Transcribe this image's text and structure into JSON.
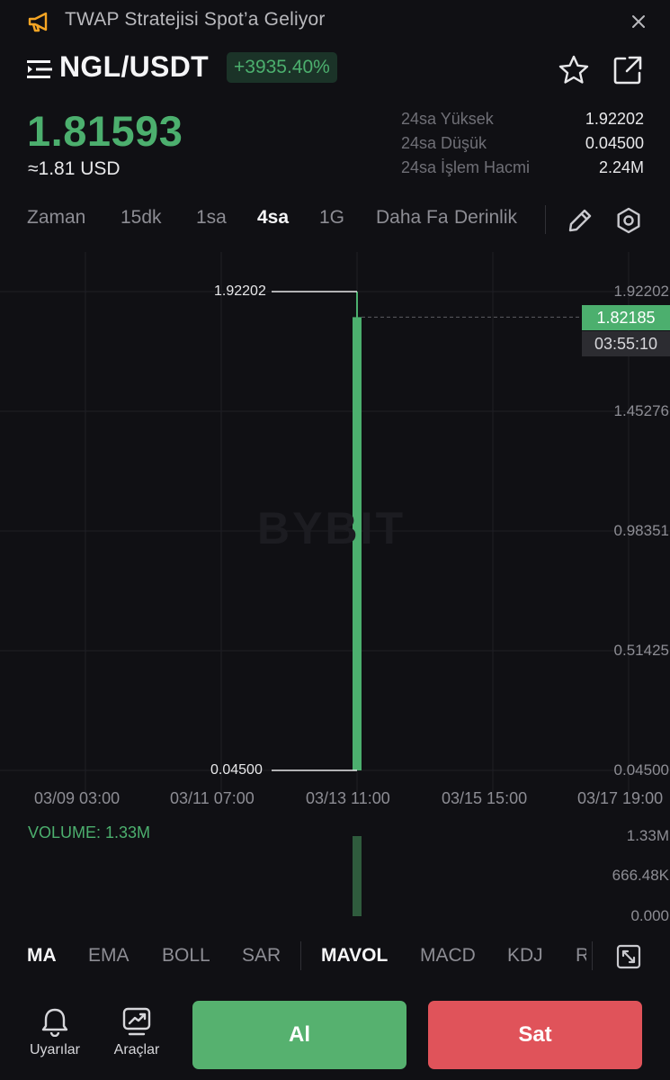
{
  "banner": {
    "text": "TWAP Stratejisi Spot’a Geliyor",
    "icon": "megaphone-icon"
  },
  "header": {
    "pair": "NGL/USDT",
    "change": "+3935.40%"
  },
  "price": {
    "last": "1.81593",
    "usd": "≈1.81 USD"
  },
  "stats": [
    {
      "label": "24sa Yüksek",
      "value": "1.92202"
    },
    {
      "label": "24sa Düşük",
      "value": "0.04500"
    },
    {
      "label": "24sa İşlem Hacmi",
      "value": "2.24M"
    }
  ],
  "timeframes": {
    "items": [
      "Zaman",
      "15dk",
      "1sa",
      "4sa",
      "1G"
    ],
    "active": "4sa",
    "more": "Daha Fazla",
    "depth": "Derinlik"
  },
  "chart": {
    "y_axis_labels": [
      "1.92202",
      "1.45276",
      "0.98351",
      "0.51425",
      "0.04500"
    ],
    "x_axis_labels": [
      "03/09 03:00",
      "03/11 07:00",
      "03/13 11:00",
      "03/15 15:00",
      "03/17 19:00"
    ],
    "high_marker": "1.92202",
    "low_marker": "0.04500",
    "current_price_tag": "1.82185",
    "countdown": "03:55:10",
    "watermark": "BYBIT",
    "volume_title": "VOLUME: 1.33M",
    "volume_axis_labels": [
      "1.33M",
      "666.48K",
      "0.000"
    ]
  },
  "chart_data": {
    "type": "candlestick",
    "title": "",
    "x": [
      "03/09 03:00",
      "03/11 07:00",
      "03/13 11:00",
      "03/15 15:00",
      "03/17 19:00"
    ],
    "ylim": [
      0.045,
      1.92202
    ],
    "candles": [
      {
        "time": "03/13 11:00",
        "open": 0.045,
        "high": 1.92202,
        "low": 0.045,
        "close": 1.82185
      }
    ],
    "volume": [
      {
        "time": "03/13 11:00",
        "value": 1330000
      }
    ],
    "volume_ylim": [
      0,
      1330000
    ],
    "colors": {
      "up": "#4caf6e",
      "volume_up": "#2f5b3d"
    },
    "grid": true
  },
  "indicators": {
    "items": [
      "MA",
      "EMA",
      "BOLL",
      "SAR",
      "MAVOL",
      "MACD",
      "KDJ",
      "RSI"
    ],
    "active": [
      "MA",
      "MAVOL"
    ]
  },
  "bottom": {
    "alerts_label": "Uyarılar",
    "tools_label": "Araçlar",
    "buy_label": "Al",
    "sell_label": "Sat"
  },
  "colors": {
    "green": "#4caf6e",
    "red": "#e0535a",
    "background": "#101014"
  }
}
